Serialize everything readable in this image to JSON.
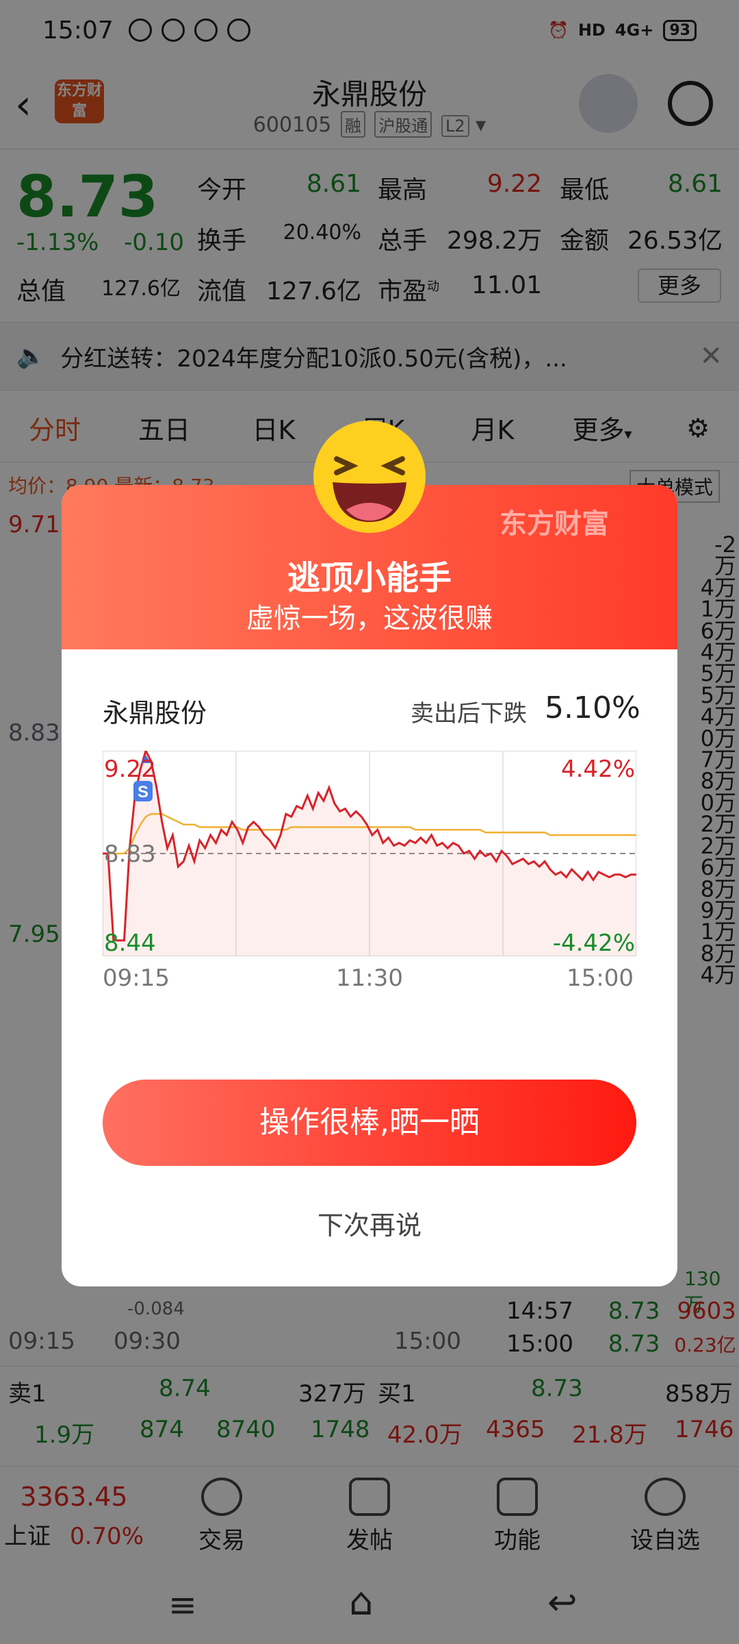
{
  "status": {
    "time": "15:07",
    "hd": "HD",
    "net": "4G+",
    "battery": "93"
  },
  "header": {
    "name": "永鼎股份",
    "code": "600105",
    "tags": [
      "融",
      "沪股通",
      "L2"
    ],
    "logo": "东方财富"
  },
  "quote": {
    "price": "8.73",
    "pct": "-1.13%",
    "change": "-0.10",
    "open_label": "今开",
    "open": "8.61",
    "high_label": "最高",
    "high": "9.22",
    "low_label": "最低",
    "low": "8.61",
    "turnover_label": "换手",
    "turnover": "20.40%",
    "volume_label": "总手",
    "volume": "298.2万",
    "amount_label": "金额",
    "amount": "26.53亿",
    "mktcap_label": "总值",
    "mktcap": "127.6亿",
    "float_label": "流值",
    "float": "127.6亿",
    "pe_label": "市盈",
    "pe_sup": "动",
    "pe": "11.01",
    "more": "更多"
  },
  "notice": {
    "text": "分红送转：2024年度分配10派0.50元(含税)，..."
  },
  "tabs": [
    "分时",
    "五日",
    "日K",
    "周K",
    "月K",
    "更多"
  ],
  "background": {
    "avg_label": "均价：8.90 最新：8.73",
    "bigorder": "大单模式",
    "y_top": "9.71",
    "y_mid": "8.83",
    "y_bot": "7.95",
    "time_labels": [
      "09:15",
      "09:30",
      "15:00"
    ],
    "vol_label": "-0.084",
    "trades": [
      {
        "time": "14:57",
        "price": "8.73",
        "vol": "9603"
      },
      {
        "time": "15:00",
        "price": "8.73",
        "vol": "0.23亿"
      }
    ],
    "trade_last_vol": "130万",
    "right_col": [
      "-2",
      "万",
      "4万",
      "1万",
      "6万",
      "4万",
      "5万",
      "5万",
      "4万",
      "0万",
      "7万",
      "8万",
      "0万",
      "2万",
      "2万",
      "6万",
      "8万",
      "9万",
      "1万",
      "8万",
      "4万"
    ],
    "sell1": {
      "label": "卖1",
      "price": "8.74",
      "vol": "327万"
    },
    "buy1": {
      "label": "买1",
      "price": "8.73",
      "vol": "858万"
    },
    "sell_row": [
      "1.9万",
      "874",
      "8740",
      "1748"
    ],
    "buy_row": [
      "42.0万",
      "4365",
      "21.8万",
      "1746"
    ]
  },
  "bottom_nav": {
    "index_value": "3363.45",
    "index_name": "上证",
    "index_pct": "0.70%",
    "items": [
      "交易",
      "发帖",
      "功能",
      "设自选"
    ]
  },
  "modal": {
    "brand": "东方财富",
    "title": "逃顶小能手",
    "subtitle": "虚惊一场，这波很赚",
    "stock": "永鼎股份",
    "drop_label": "卖出后下跌",
    "drop_value": "5.10%",
    "share_button": "操作很棒,晒一晒",
    "later": "下次再说",
    "sell_marker": "S"
  },
  "chart_data": {
    "type": "line",
    "title": "",
    "x_ticks": [
      "09:15",
      "11:30",
      "15:00"
    ],
    "y_left": {
      "top": "9.22",
      "mid": "8.83",
      "bottom": "8.44"
    },
    "y_right": {
      "top": "4.42%",
      "bottom": "-4.42%"
    },
    "ylim": [
      8.44,
      9.22
    ],
    "reference": 8.83,
    "series": [
      {
        "values": [
          8.83,
          8.83,
          8.5,
          8.5,
          8.5,
          8.85,
          9.05,
          9.15,
          9.22,
          9.18,
          9.08,
          8.95,
          8.85,
          8.9,
          8.78,
          8.8,
          8.86,
          8.8,
          8.88,
          8.85,
          8.9,
          8.87,
          8.92,
          8.9,
          8.95,
          8.92,
          8.87,
          8.93,
          8.95,
          8.93,
          8.9,
          8.88,
          8.85,
          8.9,
          8.98,
          8.97,
          9.01,
          9.0,
          9.05,
          9.0,
          9.06,
          9.03,
          9.08,
          9.02,
          8.99,
          9.0,
          8.97,
          8.99,
          8.97,
          8.94,
          8.9,
          8.92,
          8.87,
          8.89,
          8.86,
          8.87,
          8.86,
          8.88,
          8.87,
          8.89,
          8.87,
          8.9,
          8.86,
          8.87,
          8.85,
          8.87,
          8.86,
          8.83,
          8.84,
          8.81,
          8.84,
          8.82,
          8.83,
          8.8,
          8.84,
          8.82,
          8.79,
          8.8,
          8.81,
          8.79,
          8.8,
          8.78,
          8.8,
          8.77,
          8.75,
          8.76,
          8.74,
          8.77,
          8.75,
          8.73,
          8.76,
          8.73,
          8.76,
          8.75,
          8.74,
          8.75,
          8.75,
          8.74,
          8.75,
          8.75
        ]
      },
      {
        "values": [
          8.83,
          8.83,
          8.83,
          8.83,
          8.83,
          8.85,
          8.9,
          8.94,
          8.97,
          8.98,
          8.98,
          8.98,
          8.97,
          8.96,
          8.95,
          8.94,
          8.94,
          8.94,
          8.93,
          8.93,
          8.93,
          8.93,
          8.93,
          8.93,
          8.93,
          8.93,
          8.92,
          8.92,
          8.92,
          8.92,
          8.92,
          8.92,
          8.92,
          8.92,
          8.92,
          8.93,
          8.93,
          8.93,
          8.93,
          8.93,
          8.93,
          8.93,
          8.93,
          8.93,
          8.93,
          8.93,
          8.93,
          8.93,
          8.93,
          8.93,
          8.93,
          8.93,
          8.93,
          8.93,
          8.93,
          8.93,
          8.93,
          8.93,
          8.92,
          8.92,
          8.92,
          8.92,
          8.92,
          8.92,
          8.92,
          8.92,
          8.92,
          8.92,
          8.92,
          8.92,
          8.92,
          8.91,
          8.91,
          8.91,
          8.91,
          8.91,
          8.91,
          8.91,
          8.91,
          8.91,
          8.91,
          8.91,
          8.91,
          8.9,
          8.9,
          8.9,
          8.9,
          8.9,
          8.9,
          8.9,
          8.9,
          8.9,
          8.9,
          8.9,
          8.9,
          8.9,
          8.9,
          8.9,
          8.9,
          8.9
        ]
      }
    ],
    "grid": true
  },
  "colors": {
    "red": "#e0281f",
    "green": "#1a8c2a",
    "accent": "#e9531f",
    "avg_line": "#f0b030"
  }
}
